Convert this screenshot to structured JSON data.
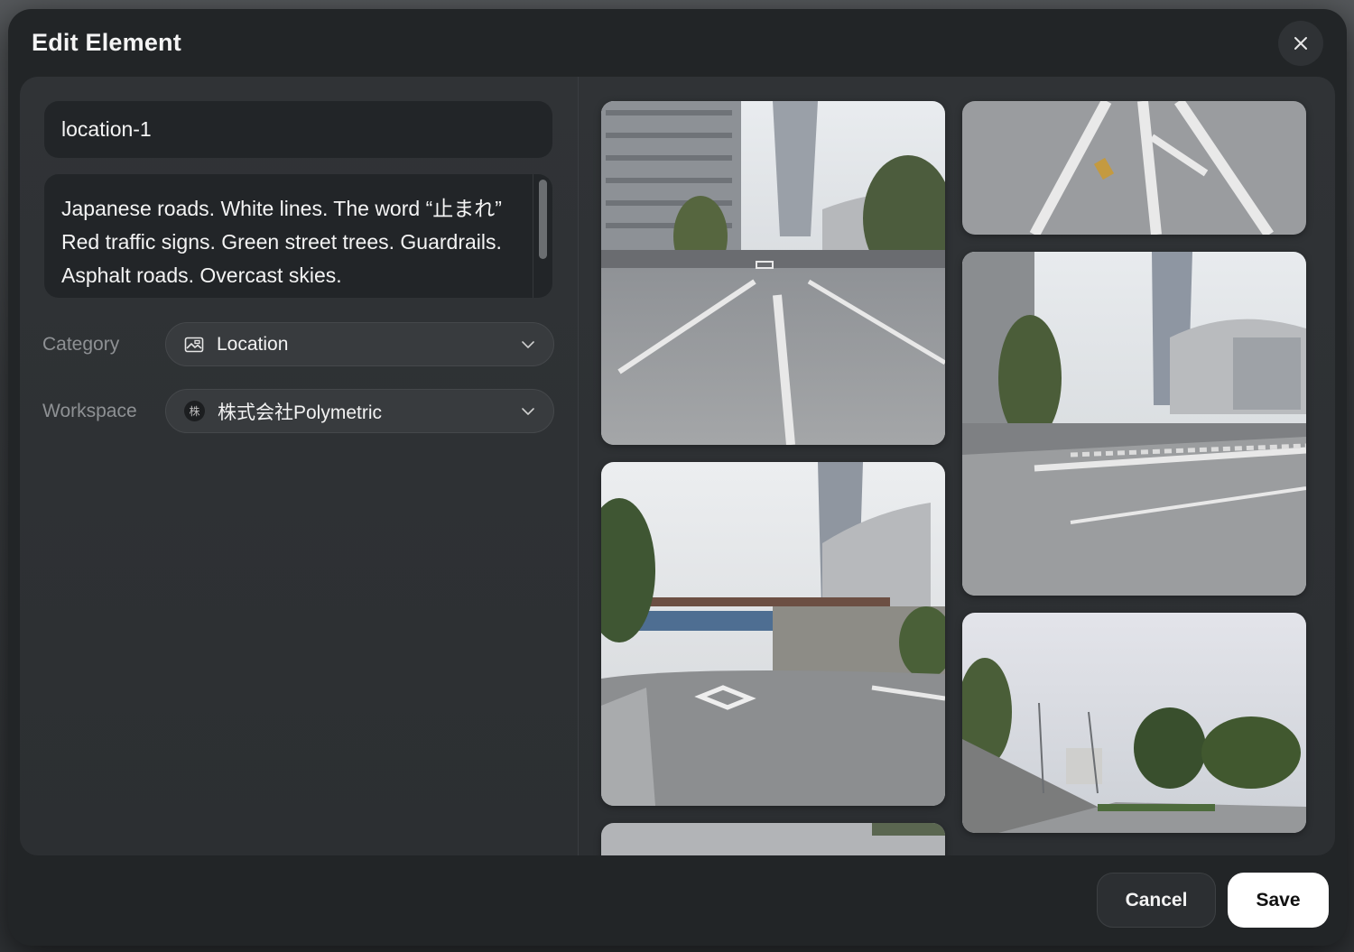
{
  "dialog": {
    "title": "Edit Element"
  },
  "form": {
    "name_value": "location-1",
    "description": "Japanese roads. White lines. The word “止まれ” Red traffic signs. Green street trees. Guardrails. Asphalt roads. Overcast skies.",
    "category": {
      "label": "Category",
      "value": "Location",
      "icon": "image-icon"
    },
    "workspace": {
      "label": "Workspace",
      "badge": "株",
      "value": "株式会社Polymetric"
    }
  },
  "gallery": {
    "photos": [
      {
        "name": "road-photo-1",
        "icon": "street-photo"
      },
      {
        "name": "road-photo-2",
        "icon": "road-marking-closeup"
      },
      {
        "name": "road-photo-3",
        "icon": "street-photo"
      },
      {
        "name": "road-photo-4",
        "icon": "street-photo"
      },
      {
        "name": "road-photo-5",
        "icon": "street-photo"
      },
      {
        "name": "road-photo-6",
        "icon": "street-photo"
      }
    ]
  },
  "actions": {
    "cancel_label": "Cancel",
    "save_label": "Save"
  },
  "colors": {
    "modal_bg": "#222527",
    "panel_bg": "#2e3134",
    "save_bg": "#ffffff"
  }
}
